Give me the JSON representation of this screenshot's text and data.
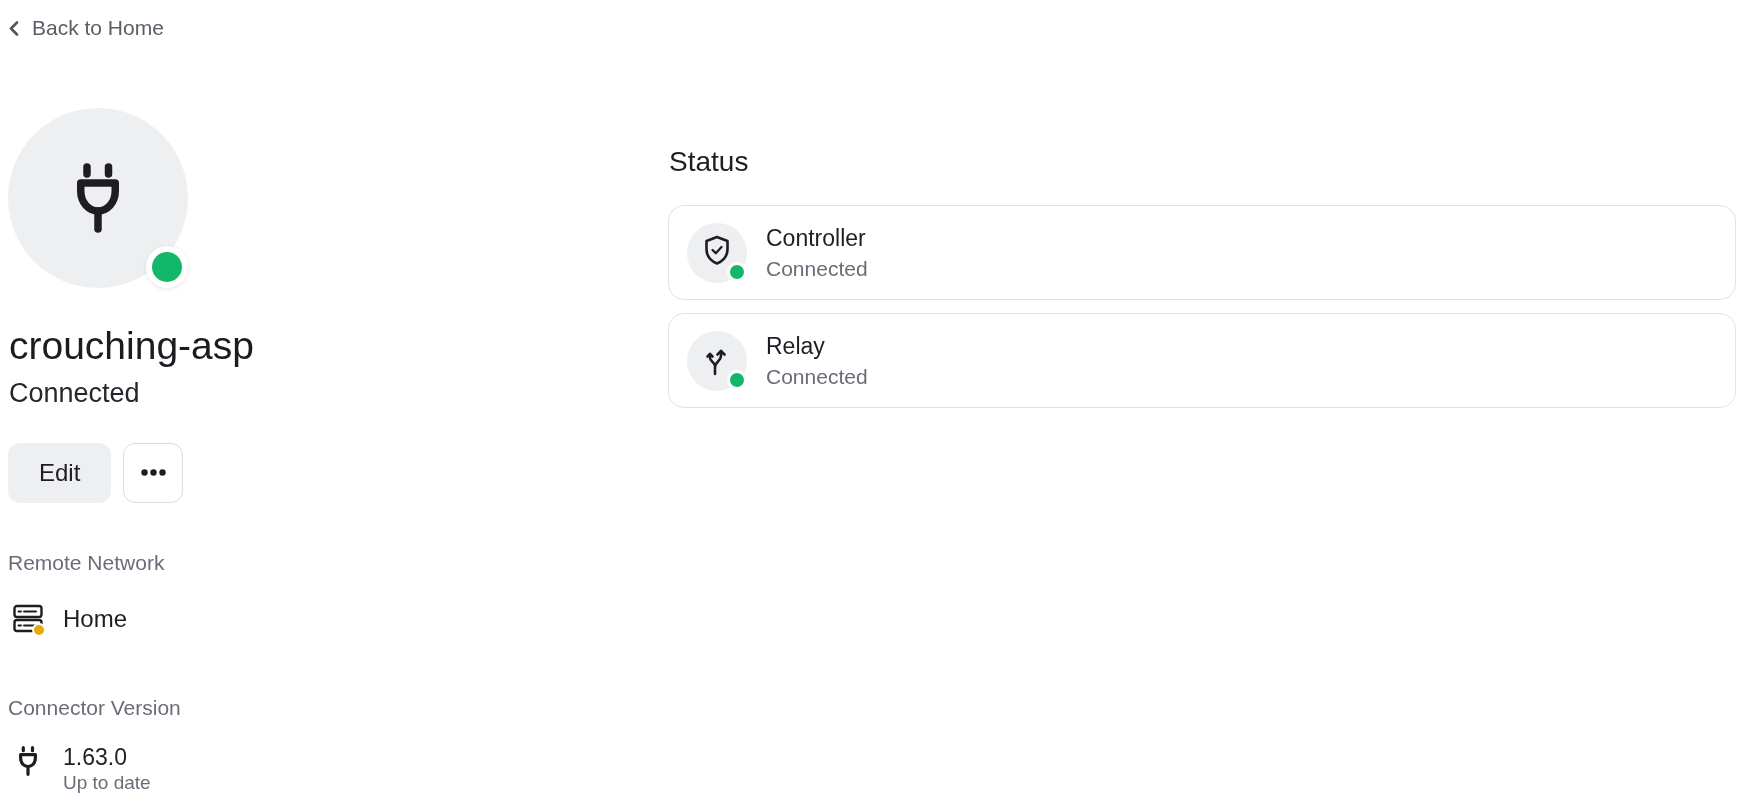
{
  "back_link": {
    "label": "Back to Home"
  },
  "connector": {
    "name": "crouching-asp",
    "status": "Connected",
    "online": true
  },
  "actions": [
    {
      "kind": "edit",
      "label": "Edit"
    },
    {
      "kind": "more"
    }
  ],
  "details": [
    {
      "kind": "network",
      "label": "Remote Network",
      "value": "Home",
      "color": "#e9a909"
    },
    {
      "kind": "version",
      "label": "Connector Version",
      "value": "1.63.0",
      "note": "Up to date"
    }
  ],
  "status": {
    "title": "Status",
    "items": [
      {
        "kind": "controller",
        "name": "Controller",
        "state": "Connected",
        "color": "#12b76a"
      },
      {
        "kind": "relay",
        "name": "Relay",
        "state": "Connected",
        "color": "#12b76a"
      }
    ]
  }
}
